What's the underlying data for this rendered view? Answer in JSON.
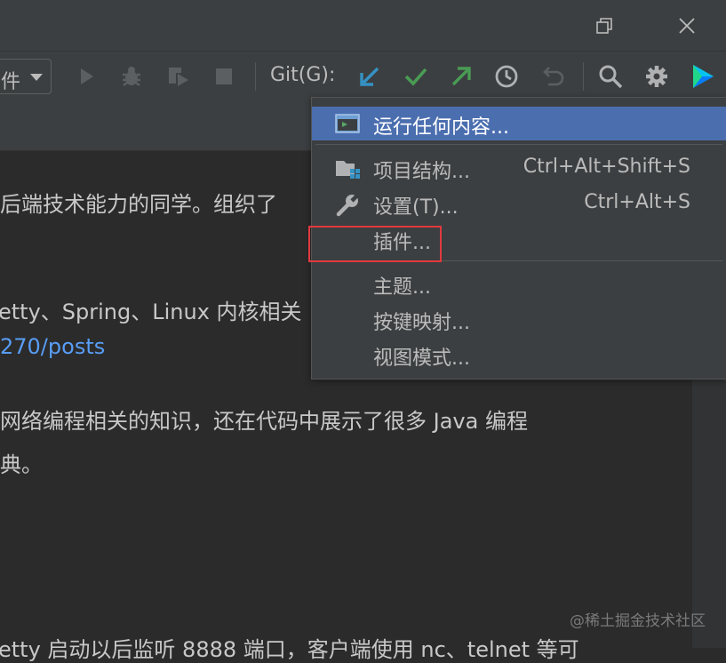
{
  "window": {
    "restore_icon": "restore-icon",
    "close_icon": "close-icon"
  },
  "toolbar": {
    "combo_text": "件",
    "git_label": "Git(G):",
    "icons": [
      "run-icon",
      "debug-icon",
      "coverage-icon",
      "stop-icon",
      "git-update-icon",
      "git-commit-icon",
      "git-push-icon",
      "history-icon",
      "rollback-icon",
      "search-icon",
      "gear-icon",
      "toolbox-logo-icon"
    ]
  },
  "editor": {
    "lines": [
      "后端技术能力的同学。组织了",
      "etty、Spring、Linux 内核相关",
      "270/posts",
      "网络编程相关的知识，还在代码中展示了很多 Java 编程",
      "典。",
      "etty 启动以后监听 8888 端口，客户端使用 nc、telnet 等可"
    ]
  },
  "menu": {
    "items": [
      {
        "label": "运行任何内容...",
        "shortcut": "",
        "icon": "run-anything-icon"
      },
      {
        "label": "项目结构...",
        "shortcut": "Ctrl+Alt+Shift+S",
        "icon": "project-structure-icon"
      },
      {
        "label": "设置(T)...",
        "shortcut": "Ctrl+Alt+S",
        "icon": "wrench-icon"
      },
      {
        "label": "插件...",
        "shortcut": ""
      },
      {
        "label": "主题...",
        "shortcut": ""
      },
      {
        "label": "按键映射...",
        "shortcut": ""
      },
      {
        "label": "视图模式...",
        "shortcut": ""
      }
    ]
  },
  "watermark": "@稀土掘金技术社区",
  "colors": {
    "highlight": "#4b6eaf",
    "annotation": "#e0393e",
    "link": "#589df6"
  }
}
